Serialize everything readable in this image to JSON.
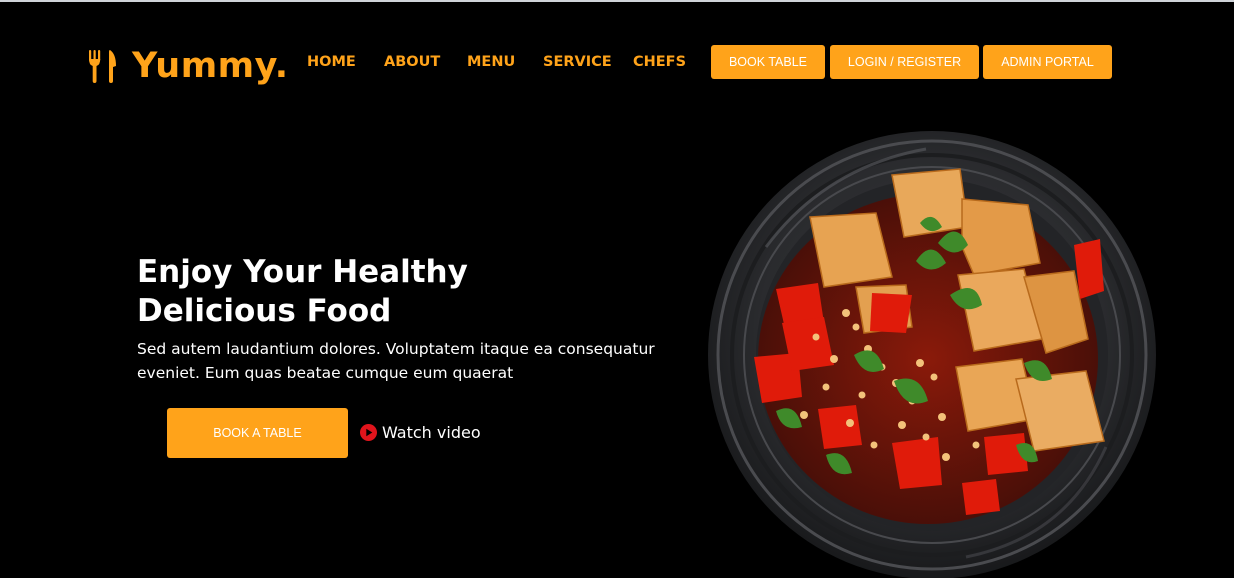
{
  "brand": {
    "name": "Yummy.",
    "icon": "fork-knife-icon"
  },
  "nav": {
    "items": [
      {
        "label": "HOME"
      },
      {
        "label": "ABOUT"
      },
      {
        "label": "MENU"
      },
      {
        "label": "SERVICE"
      },
      {
        "label": "CHEFS"
      }
    ]
  },
  "header_buttons": {
    "book_table": "BOOK TABLE",
    "login": "LOGIN / REGISTER",
    "admin": "ADMIN PORTAL"
  },
  "hero": {
    "title_line1": "Enjoy Your Healthy",
    "title_line2": "Delicious Food",
    "subtitle_line1": "Sed autem laudantium dolores. Voluptatem itaque ea consequatur",
    "subtitle_line2": "eveniet. Eum quas beatae cumque eum quaerat",
    "cta_label": "BOOK A TABLE",
    "video_label": "Watch video",
    "video_icon": "play-circle-icon",
    "image": "food-plate-image"
  },
  "colors": {
    "accent": "#ffa31a",
    "background": "#000000",
    "text": "#ffffff",
    "play_icon": "#e0141c"
  }
}
